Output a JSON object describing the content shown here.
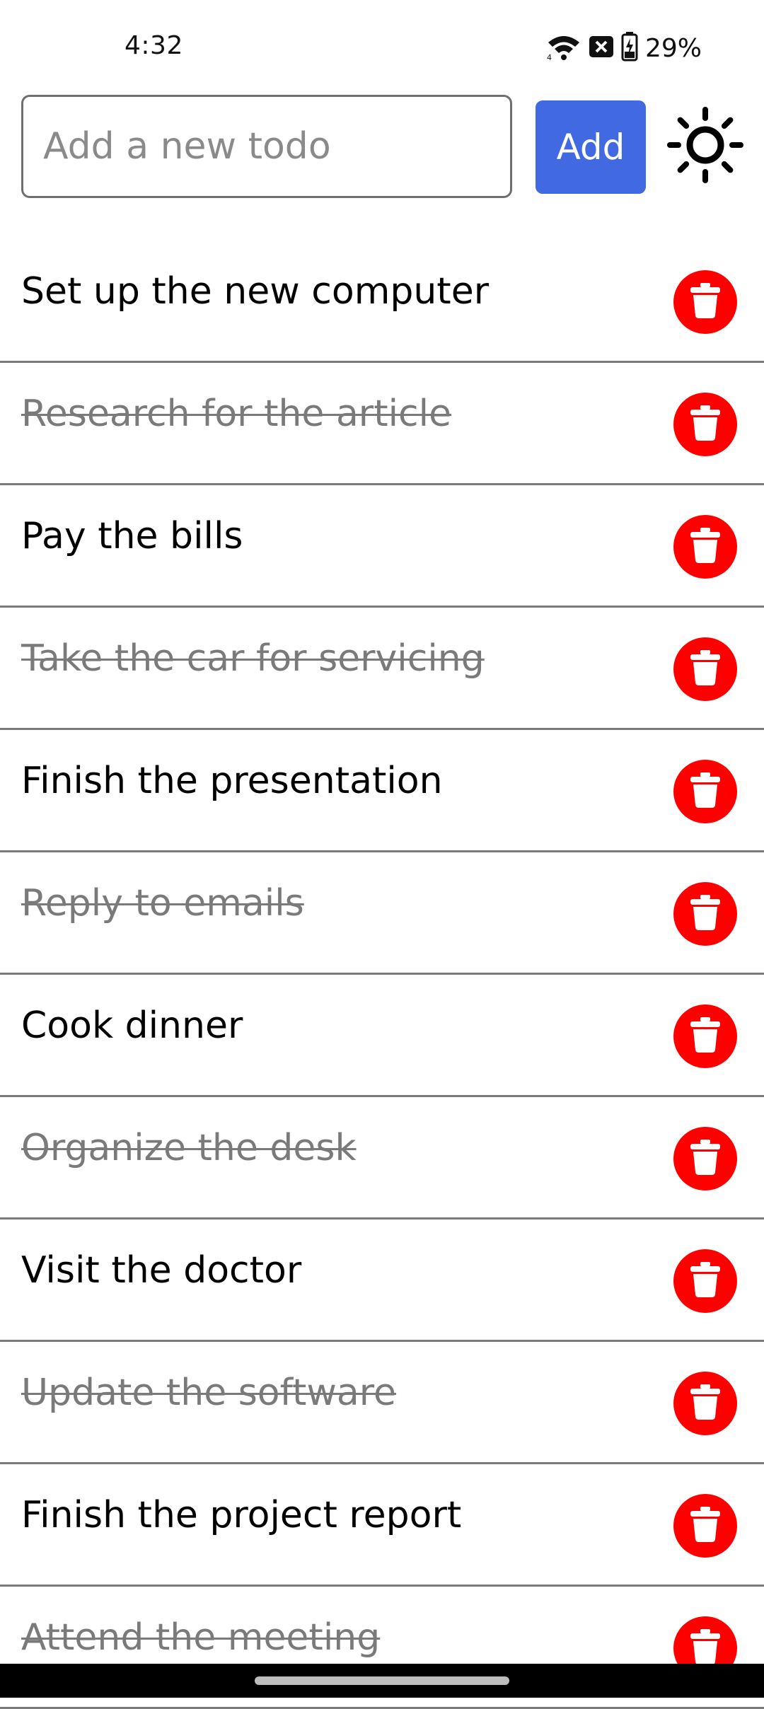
{
  "status_bar": {
    "time": "4:32",
    "battery_percent": "29%",
    "icons": [
      "wifi-icon",
      "no-sim-icon",
      "battery-charging-icon"
    ]
  },
  "header": {
    "input_placeholder": "Add a new todo",
    "input_value": "",
    "add_label": "Add",
    "theme_icon": "sun-icon"
  },
  "colors": {
    "accent": "#4169e1",
    "delete": "#ff0000",
    "done_text": "#7a7a7a"
  },
  "todos": [
    {
      "text": "Set up the new computer",
      "done": false
    },
    {
      "text": "Research for the article",
      "done": true
    },
    {
      "text": "Pay the bills",
      "done": false
    },
    {
      "text": "Take the car for servicing",
      "done": true
    },
    {
      "text": "Finish the presentation",
      "done": false
    },
    {
      "text": "Reply to emails",
      "done": true
    },
    {
      "text": "Cook dinner",
      "done": false
    },
    {
      "text": "Organize the desk",
      "done": true
    },
    {
      "text": "Visit the doctor",
      "done": false
    },
    {
      "text": "Update the software",
      "done": true
    },
    {
      "text": "Finish the project report",
      "done": false
    },
    {
      "text": "Attend the meeting",
      "done": true
    }
  ]
}
